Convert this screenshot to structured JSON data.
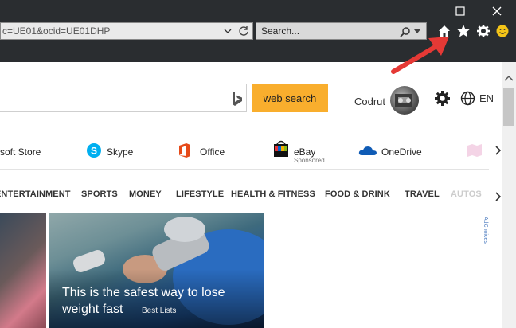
{
  "addressBar": {
    "url": "c=UE01&ocid=UE01DHP"
  },
  "searchBox": {
    "placeholder": "Search..."
  },
  "bing": {
    "searchButton": "web search"
  },
  "user": {
    "name": "Codrut"
  },
  "language": "EN",
  "quickLinks": [
    {
      "label": "soft Store"
    },
    {
      "label": "Skype"
    },
    {
      "label": "Office"
    },
    {
      "label": "eBay",
      "sub": "Sponsored"
    },
    {
      "label": "OneDrive"
    }
  ],
  "categories": [
    "ENTERTAINMENT",
    "SPORTS",
    "MONEY",
    "LIFESTYLE",
    "HEALTH & FITNESS",
    "FOOD & DRINK",
    "TRAVEL",
    "AUTOS"
  ],
  "card": {
    "headline": "This is the safest way to lose weight fast",
    "source": "Best Lists"
  },
  "ad": {
    "label": "AdChoices"
  },
  "colors": {
    "accentOrange": "#f9ae2d",
    "arrowRed": "#e53935",
    "chrome": "#2a2d30"
  }
}
